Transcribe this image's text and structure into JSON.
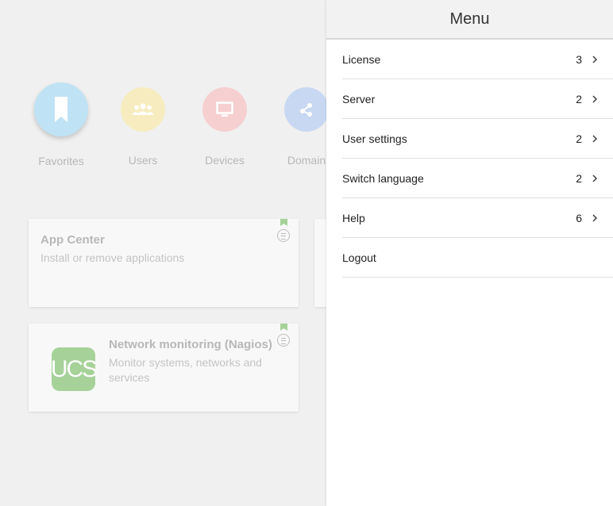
{
  "categories": [
    {
      "label": "Favorites",
      "icon": "bookmark-icon",
      "color": "#bfe3f4"
    },
    {
      "label": "Users",
      "icon": "users-icon",
      "color": "#f6ecbf"
    },
    {
      "label": "Devices",
      "icon": "monitor-icon",
      "color": "#f6cfd0"
    },
    {
      "label": "Domain",
      "icon": "share-icon",
      "color": "#c8d8f2"
    }
  ],
  "cards": [
    {
      "title": "App Center",
      "description": "Install or remove applications"
    },
    {
      "title": "Network monitoring (Nagios)",
      "description": "Monitor systems, networks and services",
      "logo_text": "UCS"
    }
  ],
  "menu": {
    "title": "Menu",
    "items": [
      {
        "label": "License",
        "count": "3"
      },
      {
        "label": "Server",
        "count": "2"
      },
      {
        "label": "User settings",
        "count": "2"
      },
      {
        "label": "Switch language",
        "count": "2"
      },
      {
        "label": "Help",
        "count": "6"
      },
      {
        "label": "Logout",
        "count": ""
      }
    ]
  },
  "colors": {
    "accent_green": "#a6d29a",
    "panel_bg": "#ffffff"
  }
}
